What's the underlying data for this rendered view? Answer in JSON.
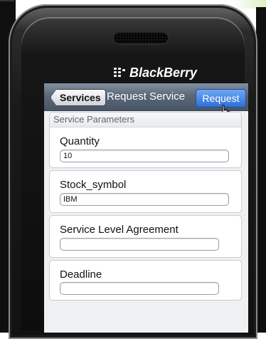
{
  "brand": {
    "name": "BlackBerry"
  },
  "navbar": {
    "back_label": "Services",
    "title": "Request Service",
    "action_label": "Request"
  },
  "form": {
    "section_header": "Service Parameters",
    "fields": [
      {
        "label": "Quantity",
        "value": "10"
      },
      {
        "label": "Stock_symbol",
        "value": "IBM"
      },
      {
        "label": "Service Level Agreement",
        "value": ""
      },
      {
        "label": "Deadline",
        "value": ""
      }
    ]
  },
  "colors": {
    "navbar": "#5b6878",
    "action_button": "#2f6fd6",
    "screen_background": "#eef0f2"
  }
}
